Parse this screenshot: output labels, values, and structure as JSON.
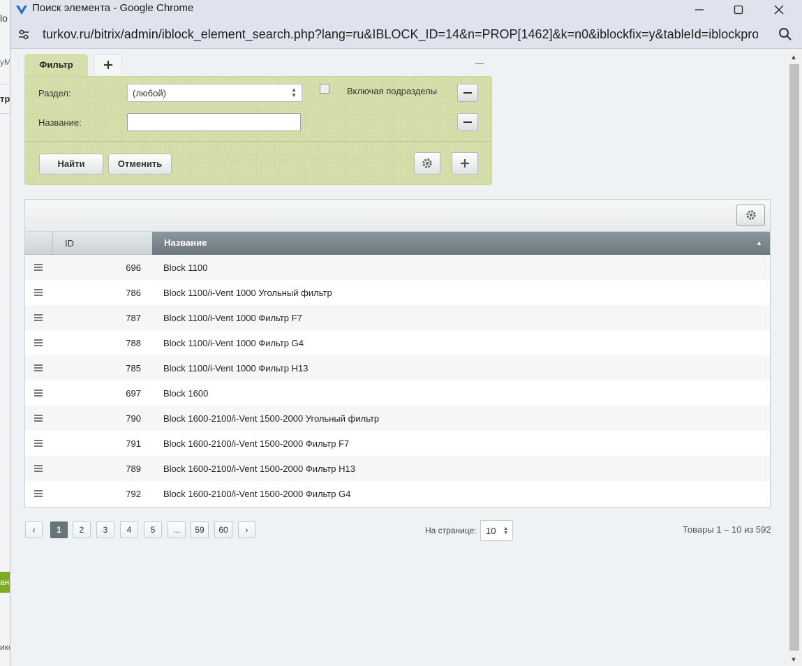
{
  "window": {
    "title": "Поиск элемента - Google Chrome",
    "url": "turkov.ru/bitrix/admin/iblock_element_search.php?lang=ru&IBLOCK_ID=14&n=PROP[1462]&k=n0&iblockfix=y&tableId=iblockpro..."
  },
  "background_fragments": {
    "a": "lo",
    "b": "уМ",
    "c": "тр",
    "d": "ан",
    "e": "ико"
  },
  "filter": {
    "tab_label": "Фильтр",
    "section_label": "Раздел:",
    "section_value": "(любой)",
    "include_subsections_label": "Включая подразделы",
    "name_label": "Название:",
    "name_value": "",
    "find_button": "Найти",
    "cancel_button": "Отменить"
  },
  "grid": {
    "columns": {
      "id": "ID",
      "name": "Название"
    },
    "rows": [
      {
        "id": "696",
        "name": "Block 1100"
      },
      {
        "id": "786",
        "name": "Block 1100/i-Vent 1000 Угольный фильтр"
      },
      {
        "id": "787",
        "name": "Block 1100/i-Vent 1000 Фильтр F7"
      },
      {
        "id": "788",
        "name": "Block 1100/i-Vent 1000 Фильтр G4"
      },
      {
        "id": "785",
        "name": "Block 1100/i-Vent 1000 Фильтр H13"
      },
      {
        "id": "697",
        "name": "Block 1600"
      },
      {
        "id": "790",
        "name": "Block 1600-2100/i-Vent 1500-2000 Угольный фильтр"
      },
      {
        "id": "791",
        "name": "Block 1600-2100/i-Vent 1500-2000 Фильтр F7"
      },
      {
        "id": "789",
        "name": "Block 1600-2100/i-Vent 1500-2000 Фильтр H13"
      },
      {
        "id": "792",
        "name": "Block 1600-2100/i-Vent 1500-2000 Фильтр G4"
      }
    ]
  },
  "pagination": {
    "prev": "‹",
    "next": "›",
    "pages": [
      "1",
      "2",
      "3",
      "4",
      "5",
      "...",
      "59",
      "60"
    ],
    "current": "1",
    "per_page_label": "На странице:",
    "per_page_value": "10",
    "total_text": "Товары 1 – 10 из 592"
  },
  "colors": {
    "filter_bg": "#d6deab",
    "header_active": "#6b777c",
    "page_active": "#68757b",
    "bitrix_logo": "#1f6fc5"
  }
}
